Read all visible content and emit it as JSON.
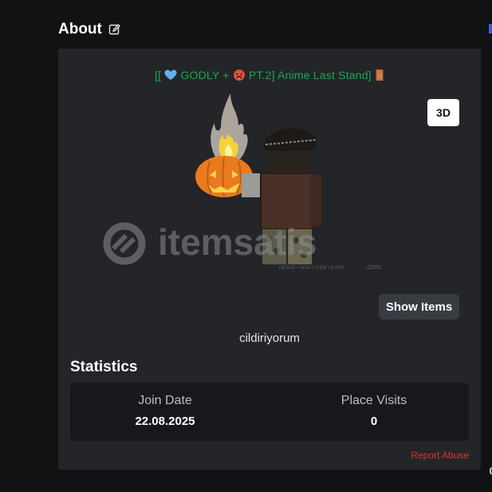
{
  "about": {
    "title": "About",
    "edit_icon": "edit-pencil-icon"
  },
  "profile": {
    "status_prefix": "[[",
    "status_part1": "GODLY +",
    "status_part2": "PT.2] Anime Last Stand]",
    "status_icons": [
      "blue-heart-emoji",
      "hot-face-emoji",
      "door-emoji"
    ],
    "status_color": "#19a94b",
    "button_3d": "3D",
    "show_items": "Show Items",
    "username": "cildiriyorum"
  },
  "statistics": {
    "title": "Statistics",
    "items": [
      {
        "label": "Join Date",
        "value": "22.08.2025"
      },
      {
        "label": "Place Visits",
        "value": "0"
      }
    ]
  },
  "report": {
    "label": "Report Abuse",
    "color": "#e0352b"
  },
  "watermark": {
    "brand": "itemsatis",
    "tagline": "HESAP • SKIN • ITEM • E-PIN",
    "suffix": ".com"
  }
}
